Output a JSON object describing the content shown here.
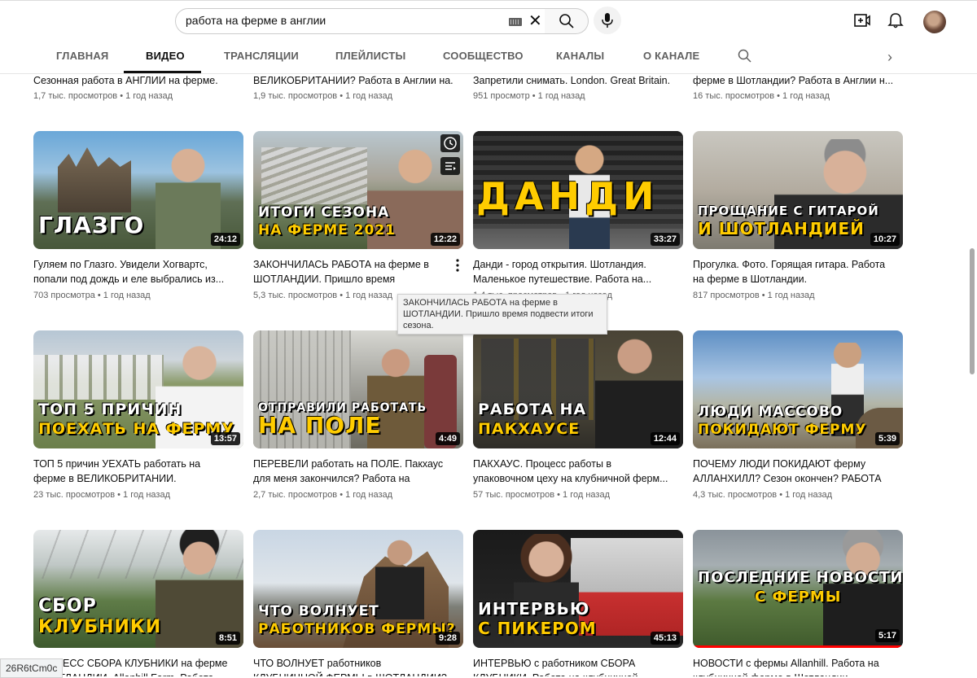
{
  "search": {
    "value": "работа на ферме в англии"
  },
  "tabs": [
    {
      "label": "ГЛАВНАЯ"
    },
    {
      "label": "ВИДЕО"
    },
    {
      "label": "ТРАНСЛЯЦИИ"
    },
    {
      "label": "ПЛЕЙЛИСТЫ"
    },
    {
      "label": "СООБЩЕСТВО"
    },
    {
      "label": "КАНАЛЫ"
    },
    {
      "label": "О КАНАЛЕ"
    }
  ],
  "top_row": [
    {
      "title": "Сезонная работа в АНГЛИИ на ферме.",
      "meta": "1,7 тыс. просмотров • 1 год назад"
    },
    {
      "title": "ВЕЛИКОБРИТАНИИ? Работа в Англии на...",
      "meta": "1,9 тыс. просмотров • 1 год назад"
    },
    {
      "title": "Запретили снимать. London. Great Britain.",
      "meta": "951 просмотр • 1 год назад"
    },
    {
      "title": "ферме в Шотландии? Работа в Англии н...",
      "meta": "16 тыс. просмотров • 1 год назад"
    }
  ],
  "videos": [
    {
      "caption": "ГЛАЗГО",
      "duration": "24:12",
      "title": "Гуляем по Глазго. Увидели Хогвартс, попали под дождь и еле выбрались из...",
      "meta": "703 просмотра • 1 год назад"
    },
    {
      "caption_lines": [
        "ИТОГИ СЕЗОНА",
        "НА ФЕРМЕ 2021"
      ],
      "duration": "12:22",
      "title": "ЗАКОНЧИЛАСЬ РАБОТА на ферме в ШОТЛАНДИИ. Пришло время подвести...",
      "meta": "5,3 тыс. просмотров • 1 год назад"
    },
    {
      "caption": "ДАНДИ",
      "duration": "33:27",
      "title": "Данди - город открытия. Шотландия. Маленькое путешествие. Работа на...",
      "meta": "1,4 тыс. просмотров • 1 год назад"
    },
    {
      "caption_lines": [
        "ПРОЩАНИЕ С ГИТАРОЙ",
        "И ШОТЛАНДИЕЙ"
      ],
      "duration": "10:27",
      "title": "Прогулка. Фото. Горящая гитара. Работа на ферме в Шотландии.",
      "meta": "817 просмотров • 1 год назад"
    },
    {
      "caption_lines": [
        "ТОП 5 ПРИЧИН",
        "ПОЕХАТЬ НА ФЕРМУ"
      ],
      "duration": "13:57",
      "title": "ТОП 5 причин УЕХАТЬ работать на ферме в ВЕЛИКОБРИТАНИИ.",
      "meta": "23 тыс. просмотров • 1 год назад"
    },
    {
      "caption_lines": [
        "ОТПРАВИЛИ РАБОТАТЬ",
        "НА ПОЛЕ"
      ],
      "duration": "4:49",
      "title": "ПЕРЕВЕЛИ работать на ПОЛЕ. Пакхаус для меня закончился? Работа на ферме...",
      "meta": "2,7 тыс. просмотров • 1 год назад"
    },
    {
      "caption_lines": [
        "РАБОТА НА",
        "ПАКХАУСЕ"
      ],
      "duration": "12:44",
      "title": "ПАКХАУС. Процесс работы в упаковочном цеху на клубничной ферм...",
      "meta": "57 тыс. просмотров • 1 год назад"
    },
    {
      "caption_lines": [
        "ЛЮДИ МАССОВО",
        "ПОКИДАЮТ ФЕРМУ"
      ],
      "duration": "5:39",
      "title": "ПОЧЕМУ ЛЮДИ ПОКИДАЮТ ферму АЛЛАНХИЛЛ? Сезон окончен? РАБОТА ...",
      "meta": "4,3 тыс. просмотров • 1 год назад"
    },
    {
      "caption_lines": [
        "СБОР",
        "КЛУБНИКИ"
      ],
      "duration": "8:51",
      "title": "ПРОЦЕСС СБОРА КЛУБНИКИ на ферме в ШОТЛАНДИИ. Allanhill Farm. Работа в..."
    },
    {
      "caption_lines": [
        "ЧТО ВОЛНУЕТ",
        "РАБОТНИКОВ ФЕРМЫ?"
      ],
      "duration": "9:28",
      "title": "ЧТО ВОЛНУЕТ работников КЛУБНИЧНОЙ ФЕРМЫ в ШОТЛАНДИИ? Работа в..."
    },
    {
      "caption_lines": [
        "ИНТЕРВЬЮ",
        "С ПИКЕРОМ"
      ],
      "duration": "45:13",
      "title": "ИНТЕРВЬЮ с работником СБОРА КЛУБНИКИ. Работа на клубничной фер..."
    },
    {
      "caption_lines": [
        "ПОСЛЕДНИЕ НОВОСТИ",
        "С ФЕРМЫ"
      ],
      "duration": "5:17",
      "title": "НОВОСТИ с фермы Allanhill. Работа на клубничной ферме в Шотландии..."
    }
  ],
  "tooltip": "ЗАКОНЧИЛАСЬ РАБОТА на ферме в ШОТЛАНДИИ. Пришло время подвести итоги сезона.",
  "status_url": "26R6tCm0c",
  "colors": {
    "caption_yellow": "#ffcc00",
    "progress_red": "#ff0000",
    "meta_gray": "#606060"
  }
}
